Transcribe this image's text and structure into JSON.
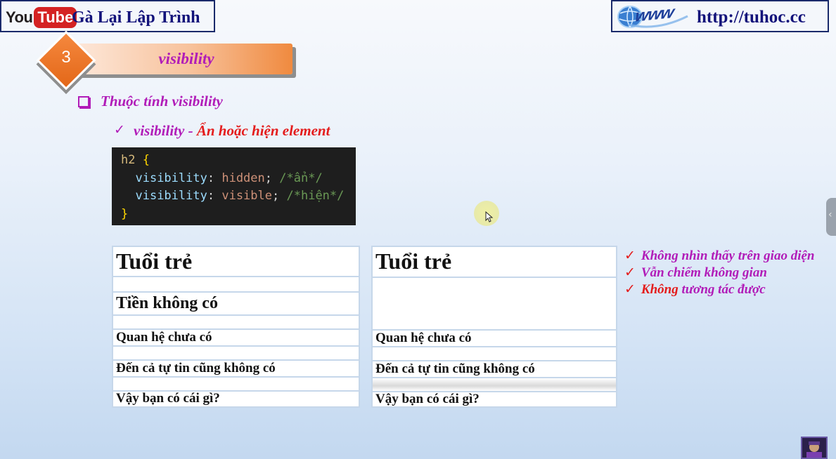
{
  "header": {
    "youtube_logo_you": "You",
    "youtube_logo_tube": "Tube",
    "channel_name": "Gà Lại Lập Trình",
    "www_logo_text": "www",
    "website_url": "http://tuhoc.cc"
  },
  "section": {
    "number": "3",
    "title": "visibility"
  },
  "bullet": {
    "heading": "Thuộc tính visibility",
    "sub_check": "✓",
    "sub_label_prop": "visibility - ",
    "sub_label_desc": "Ẩn hoặc hiện element"
  },
  "code": {
    "selector": "h2",
    "open_brace": "{",
    "close_brace": "}",
    "lines": [
      {
        "prop": "visibility",
        "colon": ":",
        "value": "hidden",
        "semi": ";",
        "comment": "/*ẩn*/"
      },
      {
        "prop": "visibility",
        "colon": ":",
        "value": "visible",
        "semi": ";",
        "comment": "/*hiện*/"
      }
    ]
  },
  "table_left": {
    "rows": [
      "Tuổi trẻ",
      "",
      "Tiền không có",
      "",
      "Quan hệ chưa có",
      "",
      "Đến cả tự tin cũng không có",
      "",
      "Vậy bạn có cái gì?"
    ]
  },
  "table_right": {
    "rows": [
      "Tuổi trẻ",
      "",
      "Quan hệ chưa có",
      "",
      "Đến cả tự tin cũng không có",
      "",
      "Vậy bạn có cái gì?"
    ]
  },
  "notes": [
    {
      "check": "✓",
      "text_red": "",
      "text_pink": "Không nhìn thấy trên giao diện"
    },
    {
      "check": "✓",
      "text_red": "",
      "text_pink": "Vẫn chiếm không gian"
    },
    {
      "check": "✓",
      "text_red": "Không",
      "text_pink": " tương tác được"
    }
  ],
  "colors": {
    "heading_pink": "#b11cb8",
    "accent_red": "#e41c1c",
    "banner_orange": "#f08a3f",
    "code_bg": "#1e1e1e"
  },
  "icons": {
    "bullet": "square-bullet-icon",
    "check": "check-icon",
    "cursor": "mouse-cursor-icon",
    "side_tab": "chevron-left-icon",
    "avatar": "channel-avatar-icon"
  }
}
